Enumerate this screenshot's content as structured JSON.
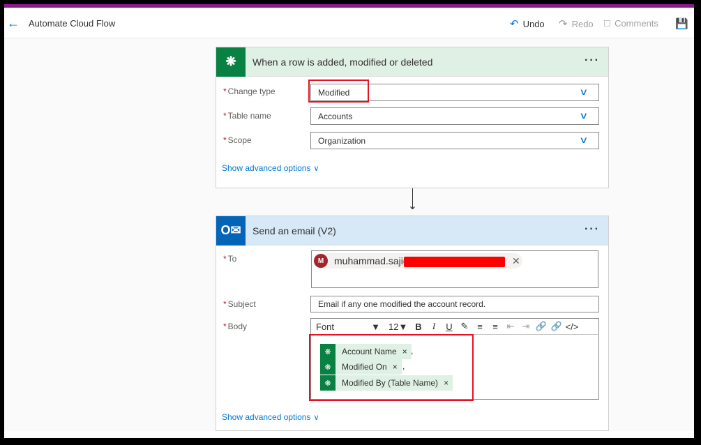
{
  "header": {
    "title": "Automate Cloud Flow",
    "undo": "Undo",
    "redo": "Redo",
    "comments": "Comments"
  },
  "trigger": {
    "title": "When a row is added, modified or deleted",
    "fields": [
      {
        "label": "Change type",
        "value": "Modified"
      },
      {
        "label": "Table name",
        "value": "Accounts"
      },
      {
        "label": "Scope",
        "value": "Organization"
      }
    ],
    "advanced": "Show advanced options"
  },
  "email": {
    "title": "Send an email (V2)",
    "to_label": "To",
    "recipient_initial": "M",
    "recipient": "muhammad.sajid",
    "subject_label": "Subject",
    "subject": "Email if any one modified the account record.",
    "body_label": "Body",
    "toolbar": {
      "font": "Font",
      "size": "12"
    },
    "tokens": [
      "Account Name",
      "Modified On",
      "Modified By (Table Name)"
    ],
    "advanced": "Show advanced options"
  },
  "colors": {
    "accent": "#0078d4",
    "dataverse": "#088142",
    "outlook": "#0364b8",
    "highlight": "#e81123"
  }
}
